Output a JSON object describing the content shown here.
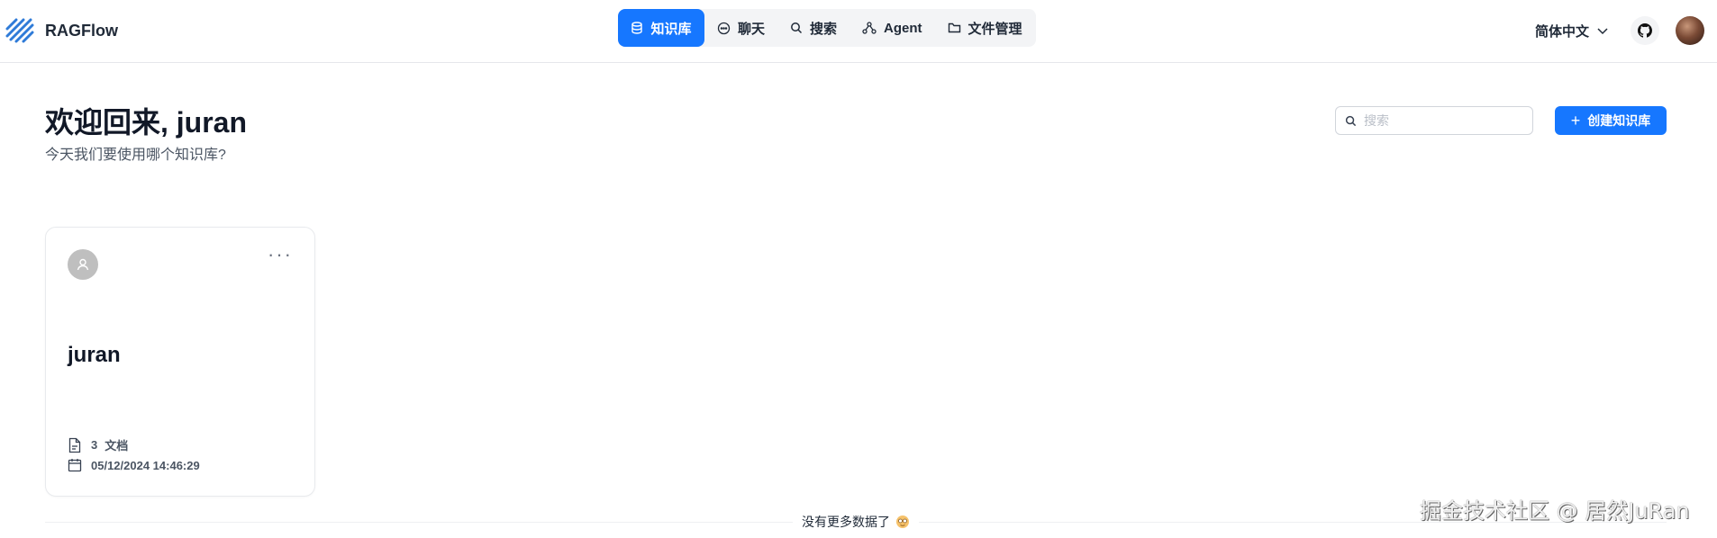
{
  "app": {
    "name": "RAGFlow",
    "accent": "#1677ff"
  },
  "nav": {
    "items": [
      {
        "label": "知识库",
        "icon": "database-icon",
        "active": true
      },
      {
        "label": "聊天",
        "icon": "chat-bubble-icon",
        "active": false
      },
      {
        "label": "搜索",
        "icon": "search-icon",
        "active": false
      },
      {
        "label": "Agent",
        "icon": "agent-graph-icon",
        "active": false
      },
      {
        "label": "文件管理",
        "icon": "folder-icon",
        "active": false
      }
    ]
  },
  "header": {
    "language": "简体中文",
    "github_icon": "github-icon",
    "user_avatar": "user-avatar"
  },
  "welcome": {
    "title": "欢迎回来, juran",
    "subtitle": "今天我们要使用哪个知识库?"
  },
  "search": {
    "placeholder": "搜索"
  },
  "create_button": {
    "label": "创建知识库"
  },
  "knowledge_bases": [
    {
      "name": "juran",
      "doc_count": "3",
      "doc_label": "文档",
      "updated": "05/12/2024 14:46:29"
    }
  ],
  "footer": {
    "no_more": "没有更多数据了"
  },
  "watermark": {
    "text": "掘金技术社区 @ 居然JuRan"
  }
}
